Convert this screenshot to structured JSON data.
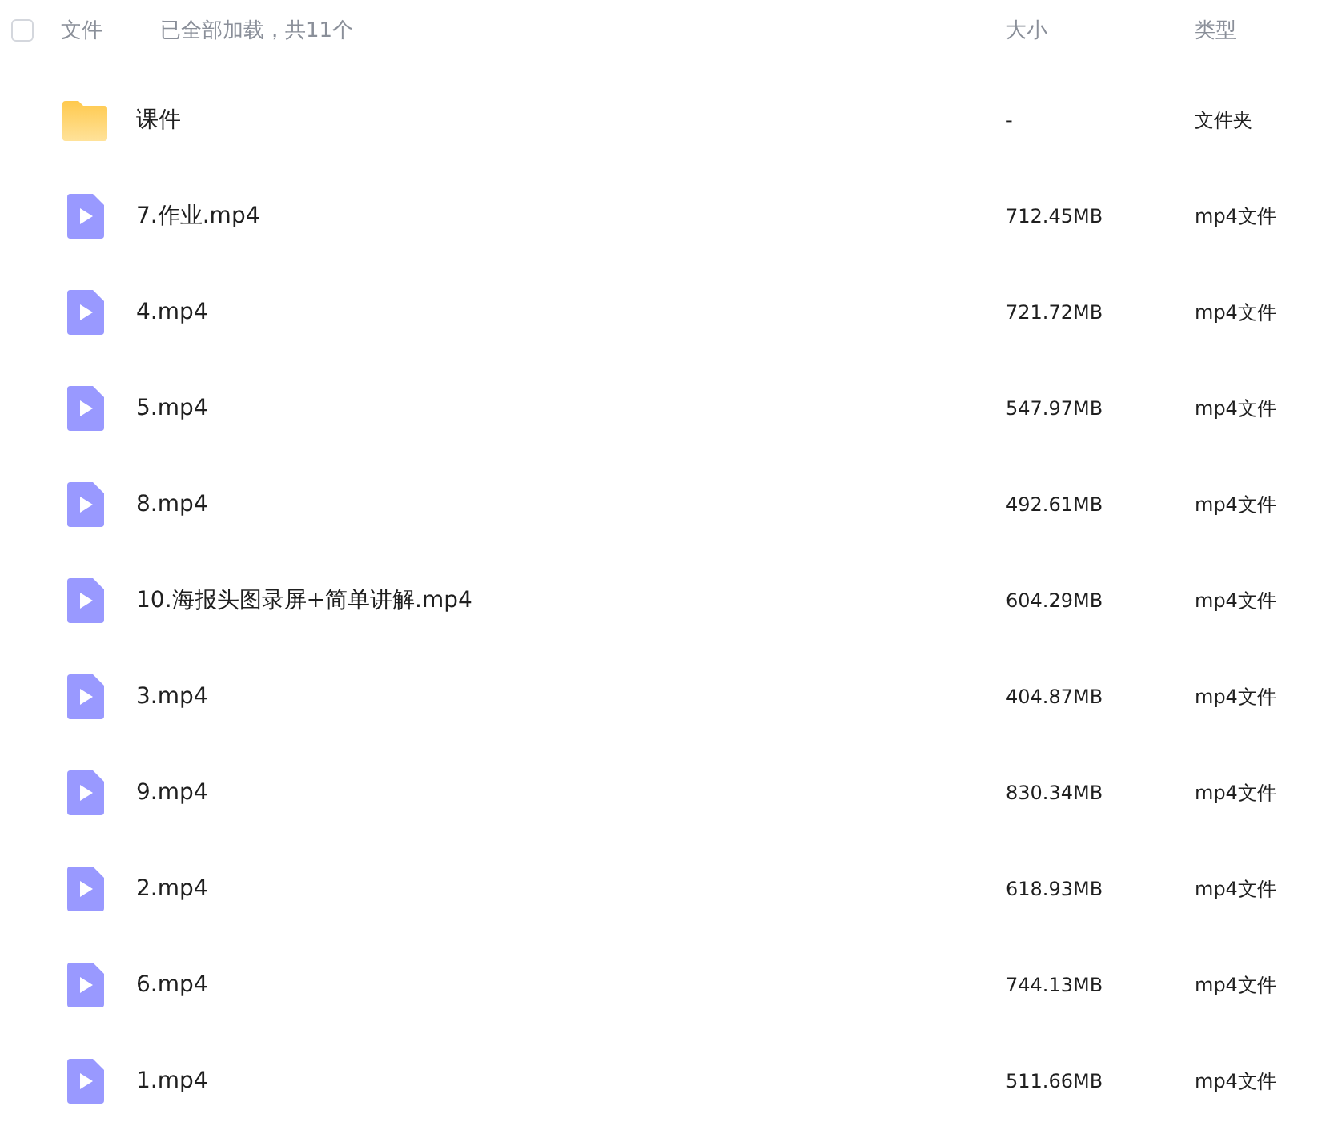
{
  "header": {
    "select_all": {
      "checked": false
    },
    "name_label": "文件",
    "status": "已全部加载，共11个",
    "size_label": "大小",
    "type_label": "类型"
  },
  "files": [
    {
      "kind": "folder",
      "name": "课件",
      "size": "-",
      "type": "文件夹"
    },
    {
      "kind": "video",
      "name": "7.作业.mp4",
      "size": "712.45MB",
      "type": "mp4文件"
    },
    {
      "kind": "video",
      "name": "4.mp4",
      "size": "721.72MB",
      "type": "mp4文件"
    },
    {
      "kind": "video",
      "name": "5.mp4",
      "size": "547.97MB",
      "type": "mp4文件"
    },
    {
      "kind": "video",
      "name": "8.mp4",
      "size": "492.61MB",
      "type": "mp4文件"
    },
    {
      "kind": "video",
      "name": "10.海报头图录屏+简单讲解.mp4",
      "size": "604.29MB",
      "type": "mp4文件"
    },
    {
      "kind": "video",
      "name": "3.mp4",
      "size": "404.87MB",
      "type": "mp4文件"
    },
    {
      "kind": "video",
      "name": "9.mp4",
      "size": "830.34MB",
      "type": "mp4文件"
    },
    {
      "kind": "video",
      "name": "2.mp4",
      "size": "618.93MB",
      "type": "mp4文件"
    },
    {
      "kind": "video",
      "name": "6.mp4",
      "size": "744.13MB",
      "type": "mp4文件"
    },
    {
      "kind": "video",
      "name": "1.mp4",
      "size": "511.66MB",
      "type": "mp4文件"
    }
  ]
}
